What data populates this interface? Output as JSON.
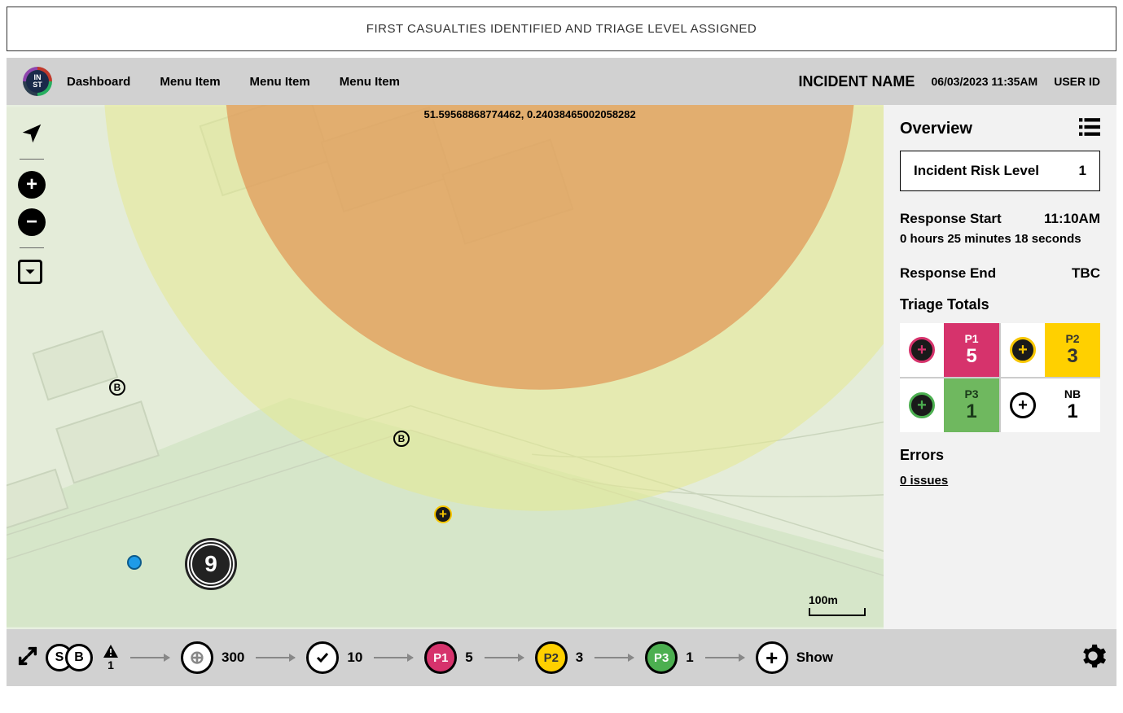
{
  "banner": "FIRST CASUALTIES IDENTIFIED AND TRIAGE LEVEL ASSIGNED",
  "header": {
    "nav": [
      "Dashboard",
      "Menu Item",
      "Menu Item",
      "Menu Item"
    ],
    "incident_name": "INCIDENT NAME",
    "datetime": "06/03/2023 11:35AM",
    "user": "USER ID"
  },
  "map": {
    "coords": "51.59568868774462, 0.24038465002058282",
    "scale_label": "100m",
    "markers": {
      "big_cluster": "9"
    }
  },
  "panel": {
    "title": "Overview",
    "risk_label": "Incident Risk Level",
    "risk_value": "1",
    "response_start_label": "Response Start",
    "response_start_time": "11:10AM",
    "elapsed": "0 hours 25 minutes 18 seconds",
    "response_end_label": "Response End",
    "response_end_value": "TBC",
    "triage_title": "Triage Totals",
    "triage": {
      "p1": {
        "label": "P1",
        "value": "5"
      },
      "p2": {
        "label": "P2",
        "value": "3"
      },
      "p3": {
        "label": "P3",
        "value": "1"
      },
      "nb": {
        "label": "NB",
        "value": "1"
      }
    },
    "errors_title": "Errors",
    "errors_link": "0 issues"
  },
  "bottom": {
    "s_label": "S",
    "b_label": "B",
    "warn_count": "1",
    "capacity": {
      "value": "300"
    },
    "checked": {
      "value": "10"
    },
    "p1": {
      "label": "P1",
      "value": "5"
    },
    "p2": {
      "label": "P2",
      "value": "3"
    },
    "p3": {
      "label": "P3",
      "value": "1"
    },
    "show_label": "Show"
  }
}
